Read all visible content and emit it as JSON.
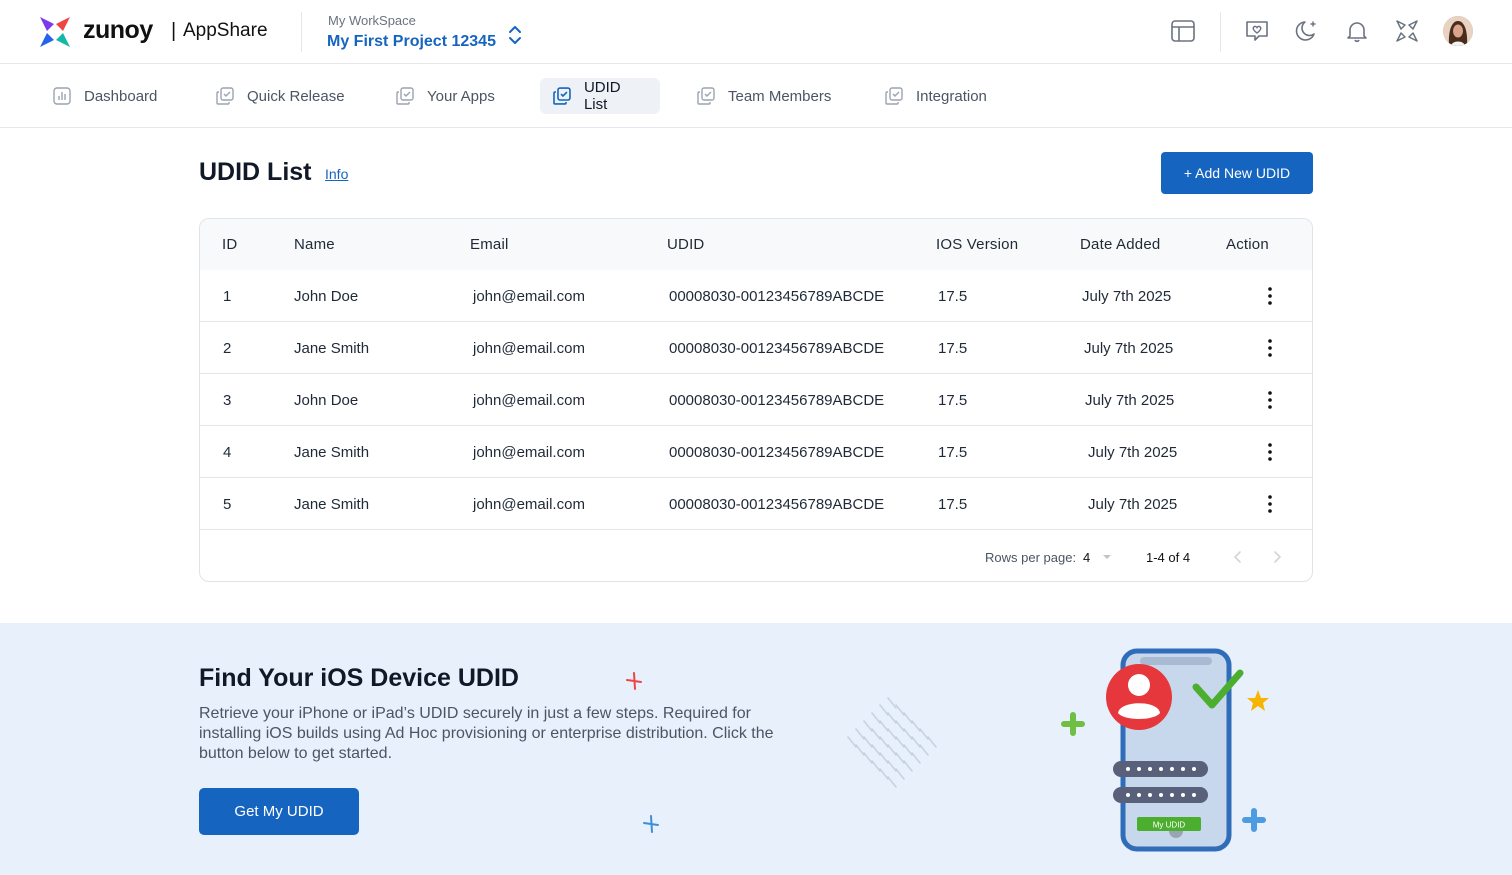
{
  "header": {
    "brand": "zunoy",
    "separator": "|",
    "product": "AppShare",
    "workspace_label": "My WorkSpace",
    "workspace_name": "My First Project 12345",
    "icons": [
      "layout-icon",
      "feedback-heart-icon",
      "dark-mode-icon",
      "notification-bell-icon",
      "apps-grid-icon"
    ]
  },
  "tabs": [
    {
      "label": "Dashboard",
      "icon": "bar-chart-icon",
      "active": false
    },
    {
      "label": "Quick Release",
      "icon": "copy-check-icon",
      "active": false
    },
    {
      "label": "Your Apps",
      "icon": "copy-check-icon",
      "active": false
    },
    {
      "label": "UDID List",
      "icon": "copy-check-icon",
      "active": true
    },
    {
      "label": "Team Members",
      "icon": "copy-check-icon",
      "active": false
    },
    {
      "label": "Integration",
      "icon": "copy-check-icon",
      "active": false
    }
  ],
  "page": {
    "title": "UDID List",
    "info_link": "Info",
    "add_button": "+ Add New UDID"
  },
  "table": {
    "columns": [
      "ID",
      "Name",
      "Email",
      "UDID",
      "IOS Version",
      "Date Added",
      "Action"
    ],
    "rows": [
      {
        "id": "1",
        "name": "John Doe",
        "email": "john@email.com",
        "udid": "00008030-00123456789ABCDE",
        "ios": "17.5",
        "date": "July 7th 2025"
      },
      {
        "id": "2",
        "name": "Jane Smith",
        "email": "john@email.com",
        "udid": "00008030-00123456789ABCDE",
        "ios": "17.5",
        "date": "July 7th 2025"
      },
      {
        "id": "3",
        "name": "John Doe",
        "email": "john@email.com",
        "udid": "00008030-00123456789ABCDE",
        "ios": "17.5",
        "date": "July 7th 2025"
      },
      {
        "id": "4",
        "name": "Jane Smith",
        "email": "john@email.com",
        "udid": "00008030-00123456789ABCDE",
        "ios": "17.5",
        "date": "July 7th 2025"
      },
      {
        "id": "5",
        "name": "Jane Smith",
        "email": "john@email.com",
        "udid": "00008030-00123456789ABCDE",
        "ios": "17.5",
        "date": "July 7th 2025"
      }
    ],
    "rows_per_page_label": "Rows per page:",
    "rows_per_page": "4",
    "range": "1-4 of 4"
  },
  "banner": {
    "title": "Find Your iOS Device UDID",
    "description": "Retrieve your iPhone or iPad’s UDID securely in just a few steps. Required for installing iOS builds using Ad Hoc provisioning or enterprise distribution. Click the button below to get started.",
    "button": "Get My UDID",
    "illustration_label": "My UDID"
  },
  "colors": {
    "primary": "#1565c0",
    "banner_bg": "#e7f0fb",
    "active_tab_bg": "#eef2f6"
  }
}
